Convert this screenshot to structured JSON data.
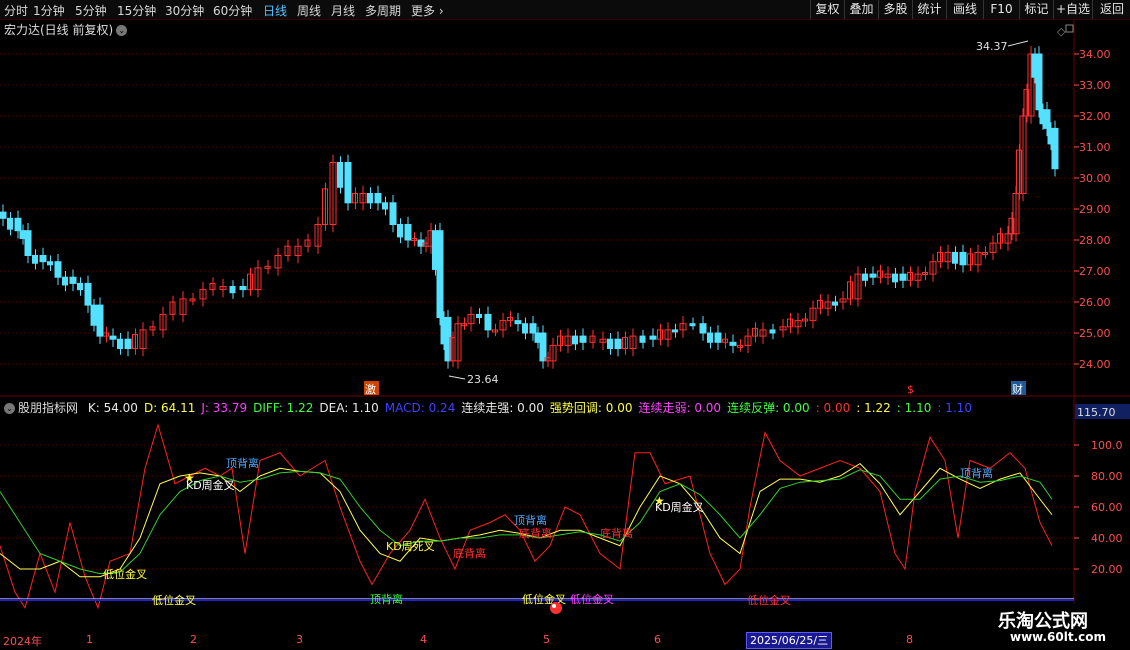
{
  "toolbar": {
    "timeframes": [
      {
        "label": "分时",
        "active": false
      },
      {
        "label": "1分钟",
        "active": false
      },
      {
        "label": "5分钟",
        "active": false
      },
      {
        "label": "15分钟",
        "active": false
      },
      {
        "label": "30分钟",
        "active": false
      },
      {
        "label": "60分钟",
        "active": false
      },
      {
        "label": "日线",
        "active": true
      },
      {
        "label": "周线",
        "active": false
      },
      {
        "label": "月线",
        "active": false
      },
      {
        "label": "多周期",
        "active": false
      },
      {
        "label": "更多",
        "active": false
      }
    ],
    "buttons": [
      "复权",
      "叠加",
      "多股",
      "统计",
      "画线",
      "F10",
      "标记",
      "+自选",
      "返回"
    ]
  },
  "main_chart": {
    "title": "宏力达(日线 前复权)",
    "price_axis": [
      "34.00",
      "33.00",
      "32.00",
      "31.00",
      "30.00",
      "29.00",
      "28.00",
      "27.00",
      "26.00",
      "25.00",
      "24.00"
    ],
    "high_label": "34.37",
    "low_label": "23.64",
    "event_markers": [
      "激",
      "$",
      "财"
    ]
  },
  "indicator": {
    "name": "股朋指标网",
    "values": [
      {
        "text": "K: 54.00",
        "color": "#e8e8e8"
      },
      {
        "text": "D: 64.11",
        "color": "#ffff40"
      },
      {
        "text": "J: 33.79",
        "color": "#ff40ff"
      },
      {
        "text": "DIFF: 1.22",
        "color": "#40ff40"
      },
      {
        "text": "DEA: 1.10",
        "color": "#e8e8e8"
      },
      {
        "text": "MACD: 0.24",
        "color": "#4040ff"
      },
      {
        "text": "连续走强: 0.00",
        "color": "#e8e8e8"
      },
      {
        "text": "强势回调: 0.00",
        "color": "#ffff40"
      },
      {
        "text": "连续走弱: 0.00",
        "color": "#ff40ff"
      },
      {
        "text": "连续反弹: 0.00",
        "color": "#40ff40"
      },
      {
        "text": ": 0.00",
        "color": "#ff3030"
      },
      {
        "text": ": 1.22",
        "color": "#ffff40"
      },
      {
        "text": ": 1.10",
        "color": "#40ff40"
      },
      {
        "text": ": 1.10",
        "color": "#4040ff"
      }
    ],
    "axis": [
      "100.0",
      "80.00",
      "60.00",
      "40.00",
      "20.00"
    ],
    "axis_top": "115.70",
    "annotations": {
      "top_div_1": "顶背离",
      "kd_golden_1": "KD周金叉",
      "low_golden_1": "低位金叉",
      "low_golden_2": "低位金叉",
      "kd_dead": "KD周死叉",
      "bottom_div_1": "底背离",
      "top_div_2": "顶背离",
      "top_div_3": "顶背离",
      "bottom_div_2": "底背离",
      "bottom_div_3": "底背离",
      "low_golden_3": "低位金叉",
      "low_golden_4": "低位金叉",
      "kd_golden_2": "KD周金叉",
      "low_golden_5": "低位金叉",
      "top_div_4": "顶背离"
    }
  },
  "date_axis": {
    "labels": [
      "2024年",
      "1",
      "2",
      "3",
      "4",
      "5",
      "6",
      "8"
    ],
    "selected": "2025/06/25/三"
  },
  "brand": {
    "name": "乐淘公式网",
    "url": "www.60lt.com"
  }
}
